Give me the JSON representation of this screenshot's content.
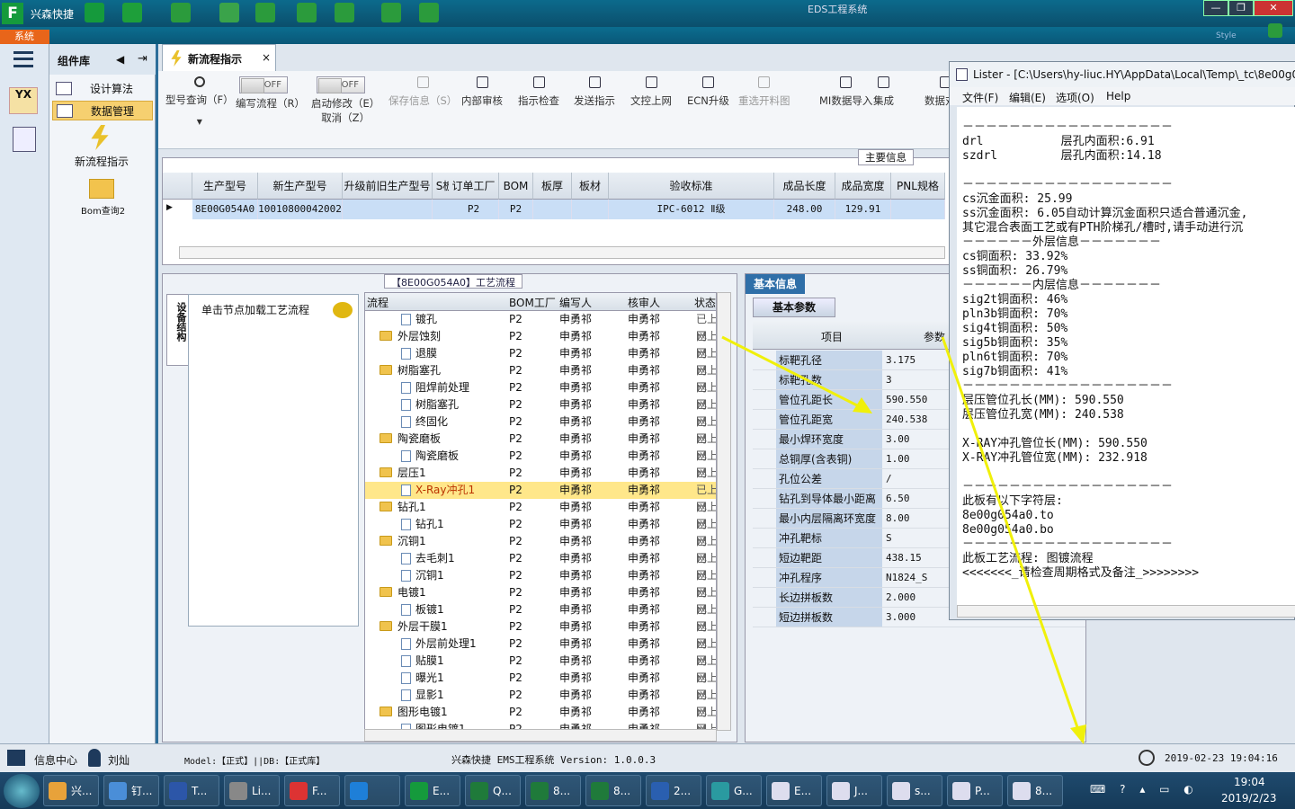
{
  "app": {
    "name": "兴森快捷",
    "title": "EDS工程系统",
    "menu_system": "系统",
    "style_label": "Style"
  },
  "toolbar_icons": [
    "logo-f-icon",
    "search-icon",
    "lifebuoy-icon",
    "table-icon",
    "scissors-icon",
    "film-icon",
    "copy-icon",
    "grid-icon",
    "user-icon",
    "chart-icon"
  ],
  "window_buttons": [
    "—",
    "❐",
    "✕"
  ],
  "left_panel": {
    "title": "组件库",
    "items": [
      {
        "label": "设计算法"
      },
      {
        "label": "数据管理"
      }
    ],
    "shortcuts": [
      {
        "label": "新流程指示"
      },
      {
        "label": "Bom查询2"
      }
    ]
  },
  "tab": {
    "label": "新流程指示",
    "close": "×"
  },
  "buttons": [
    {
      "label": "型号查询（F）",
      "icon": "magnifier-icon",
      "enabled": true
    },
    {
      "label": "编写流程（R）",
      "toggle": "OFF"
    },
    {
      "label": "启动修改（E）",
      "label2": "取消（Z）",
      "toggle": "OFF"
    },
    {
      "label": "保存信息（S）",
      "icon": "check-icon",
      "enabled": false
    },
    {
      "label": "内部审核",
      "icon": "printer-icon",
      "enabled": true
    },
    {
      "label": "指示检查",
      "icon": "check-box-icon",
      "enabled": true
    },
    {
      "label": "发送指示",
      "icon": "upload-icon",
      "enabled": true
    },
    {
      "label": "文控上网",
      "icon": "cloud-upload-icon",
      "enabled": true
    },
    {
      "label": "ECN升级",
      "icon": "ecn-icon",
      "enabled": true
    },
    {
      "label": "重选开料图",
      "icon": "image-icon",
      "enabled": false
    },
    {
      "label": "MI数据导入",
      "icon": "import-icon",
      "enabled": true
    },
    {
      "label": "集成",
      "icon": "download-icon",
      "enabled": true
    },
    {
      "label": "数据对比",
      "icon": "compare-icon",
      "enabled": true
    }
  ],
  "main_info": {
    "title": "主要信息",
    "columns": [
      "生产型号",
      "新生产型号",
      "升级前旧生产型号",
      "S板",
      "订单工厂",
      "BOM工厂",
      "板厚",
      "板材",
      "验收标准",
      "成品长度",
      "成品宽度",
      "PNL规格"
    ],
    "row": [
      "8E00G054A0",
      "10010800042002",
      "",
      "",
      "P2",
      "P2",
      "",
      "",
      "IPC-6012 Ⅱ级",
      "248.00",
      "129.91",
      ""
    ]
  },
  "process": {
    "title": "【8E00G054A0】工艺流程",
    "equip_tab": "设备结构",
    "hint": "单击节点加载工艺流程",
    "columns": [
      "流程",
      "BOM工厂",
      "编写人",
      "核审人",
      "状态"
    ],
    "rows": [
      {
        "name": "镀孔",
        "lvl": 2,
        "f": "P2",
        "w": "申勇祁",
        "r": "申勇祁",
        "s": "已上网"
      },
      {
        "name": "外层蚀刻",
        "lvl": 1,
        "f": "P2",
        "w": "申勇祁",
        "r": "申勇祁",
        "s": "已上网"
      },
      {
        "name": "退膜",
        "lvl": 2,
        "f": "P2",
        "w": "申勇祁",
        "r": "申勇祁",
        "s": "已上网"
      },
      {
        "name": "树脂塞孔",
        "lvl": 1,
        "f": "P2",
        "w": "申勇祁",
        "r": "申勇祁",
        "s": "已上网"
      },
      {
        "name": "阻焊前处理",
        "lvl": 2,
        "f": "P2",
        "w": "申勇祁",
        "r": "申勇祁",
        "s": "已上网"
      },
      {
        "name": "树脂塞孔",
        "lvl": 2,
        "f": "P2",
        "w": "申勇祁",
        "r": "申勇祁",
        "s": "已上网"
      },
      {
        "name": "终固化",
        "lvl": 2,
        "f": "P2",
        "w": "申勇祁",
        "r": "申勇祁",
        "s": "已上网"
      },
      {
        "name": "陶瓷磨板",
        "lvl": 1,
        "f": "P2",
        "w": "申勇祁",
        "r": "申勇祁",
        "s": "已上网"
      },
      {
        "name": "陶瓷磨板",
        "lvl": 2,
        "f": "P2",
        "w": "申勇祁",
        "r": "申勇祁",
        "s": "已上网"
      },
      {
        "name": "层压1",
        "lvl": 1,
        "f": "P2",
        "w": "申勇祁",
        "r": "申勇祁",
        "s": "已上网"
      },
      {
        "name": "X-Ray冲孔1",
        "lvl": 2,
        "f": "P2",
        "w": "申勇祁",
        "r": "申勇祁",
        "s": "已上网",
        "sel": true
      },
      {
        "name": "钻孔1",
        "lvl": 1,
        "f": "P2",
        "w": "申勇祁",
        "r": "申勇祁",
        "s": "已上网"
      },
      {
        "name": "钻孔1",
        "lvl": 2,
        "f": "P2",
        "w": "申勇祁",
        "r": "申勇祁",
        "s": "已上网"
      },
      {
        "name": "沉铜1",
        "lvl": 1,
        "f": "P2",
        "w": "申勇祁",
        "r": "申勇祁",
        "s": "已上网"
      },
      {
        "name": "去毛刺1",
        "lvl": 2,
        "f": "P2",
        "w": "申勇祁",
        "r": "申勇祁",
        "s": "已上网"
      },
      {
        "name": "沉铜1",
        "lvl": 2,
        "f": "P2",
        "w": "申勇祁",
        "r": "申勇祁",
        "s": "已上网"
      },
      {
        "name": "电镀1",
        "lvl": 1,
        "f": "P2",
        "w": "申勇祁",
        "r": "申勇祁",
        "s": "已上网"
      },
      {
        "name": "板镀1",
        "lvl": 2,
        "f": "P2",
        "w": "申勇祁",
        "r": "申勇祁",
        "s": "已上网"
      },
      {
        "name": "外层干膜1",
        "lvl": 1,
        "f": "P2",
        "w": "申勇祁",
        "r": "申勇祁",
        "s": "已上网"
      },
      {
        "name": "外层前处理1",
        "lvl": 2,
        "f": "P2",
        "w": "申勇祁",
        "r": "申勇祁",
        "s": "已上网"
      },
      {
        "name": "贴膜1",
        "lvl": 2,
        "f": "P2",
        "w": "申勇祁",
        "r": "申勇祁",
        "s": "已上网"
      },
      {
        "name": "曝光1",
        "lvl": 2,
        "f": "P2",
        "w": "申勇祁",
        "r": "申勇祁",
        "s": "已上网"
      },
      {
        "name": "显影1",
        "lvl": 2,
        "f": "P2",
        "w": "申勇祁",
        "r": "申勇祁",
        "s": "已上网"
      },
      {
        "name": "图形电镀1",
        "lvl": 1,
        "f": "P2",
        "w": "申勇祁",
        "r": "申勇祁",
        "s": "已上网"
      },
      {
        "name": "图形电镀1",
        "lvl": 2,
        "f": "P2",
        "w": "申勇祁",
        "r": "申勇祁",
        "s": "已上网"
      }
    ]
  },
  "basic": {
    "tab": "基本信息",
    "sub_tab": "基本参数",
    "col_item": "项目",
    "col_param": "参数",
    "rows": [
      {
        "k": "标靶孔径",
        "v": "3.175"
      },
      {
        "k": "标靶孔数",
        "v": "3"
      },
      {
        "k": "管位孔距长",
        "v": "590.550"
      },
      {
        "k": "管位孔距宽",
        "v": "240.538"
      },
      {
        "k": "最小焊环宽度",
        "v": "3.00"
      },
      {
        "k": "总铜厚(含表铜)",
        "v": "1.00"
      },
      {
        "k": "孔位公差",
        "v": "/"
      },
      {
        "k": "钻孔到导体最小距离",
        "v": "6.50"
      },
      {
        "k": "最小内层隔离环宽度",
        "v": "8.00"
      },
      {
        "k": "冲孔靶标",
        "v": "S"
      },
      {
        "k": "短边靶距",
        "v": "438.15"
      },
      {
        "k": "冲孔程序",
        "v": "N1824_S"
      },
      {
        "k": "长边拼板数",
        "v": "2.000"
      },
      {
        "k": "短边拼板数",
        "v": "3.000"
      }
    ]
  },
  "lister": {
    "title": "Lister - [C:\\Users\\hy-liuc.HY\\AppData\\Local\\Temp\\_tc\\8e00g0",
    "menu": [
      "文件(F)",
      "编辑(E)",
      "选项(O)",
      "Help"
    ],
    "text": "－－－－－－－－－－－－－－－－－－\ndrl           层孔内面积:6.91\nszdrl         层孔内面积:14.18\n\n－－－－－－－－－－－－－－－－－－\ncs沉金面积: 25.99\nss沉金面积: 6.05自动计算沉金面积只适合普通沉金,\n其它混合表面工艺或有PTH阶梯孔/槽时,请手动进行沉\n－－－－－－外层信息－－－－－－－\ncs铜面积: 33.92%\nss铜面积: 26.79%\n－－－－－－内层信息－－－－－－－\nsig2t铜面积: 46%\npln3b铜面积: 70%\nsig4t铜面积: 50%\nsig5b铜面积: 35%\npln6t铜面积: 70%\nsig7b铜面积: 41%\n－－－－－－－－－－－－－－－－－－\n层压管位孔长(MM): 590.550\n层压管位孔宽(MM): 240.538\n\nX-RAY冲孔管位长(MM): 590.550\nX-RAY冲孔管位宽(MM): 232.918\n\n－－－－－－－－－－－－－－－－－－\n此板有以下字符层:\n8e00g054a0.to\n8e00g054a0.bo\n－－－－－－－－－－－－－－－－－－\n此板工艺流程: 图镀流程\n<<<<<<<_请检查周期格式及备注_>>>>>>>>"
  },
  "status": {
    "center": "信息中心",
    "user": "刘灿",
    "model": "Model:【正式】||DB:【正式库】",
    "version": "兴森快捷  EMS工程系统  Version: 1.0.0.3",
    "datetime": "2019-02-23 19:04:16"
  },
  "taskbar": {
    "items": [
      {
        "label": "兴..."
      },
      {
        "label": "钉..."
      },
      {
        "label": "T..."
      },
      {
        "label": "Li..."
      },
      {
        "label": "F..."
      },
      {
        "label": ""
      },
      {
        "label": "E..."
      },
      {
        "label": "Q..."
      },
      {
        "label": "8..."
      },
      {
        "label": "8..."
      },
      {
        "label": "2..."
      },
      {
        "label": "G..."
      },
      {
        "label": "E..."
      },
      {
        "label": "J..."
      },
      {
        "label": "s..."
      },
      {
        "label": "P..."
      },
      {
        "label": "8..."
      }
    ],
    "time": "19:04",
    "date": "2019/2/23"
  },
  "colors": {
    "arrow": "#f0f00a",
    "selection": "#ffe78a",
    "accent": "#2f6fa8"
  }
}
